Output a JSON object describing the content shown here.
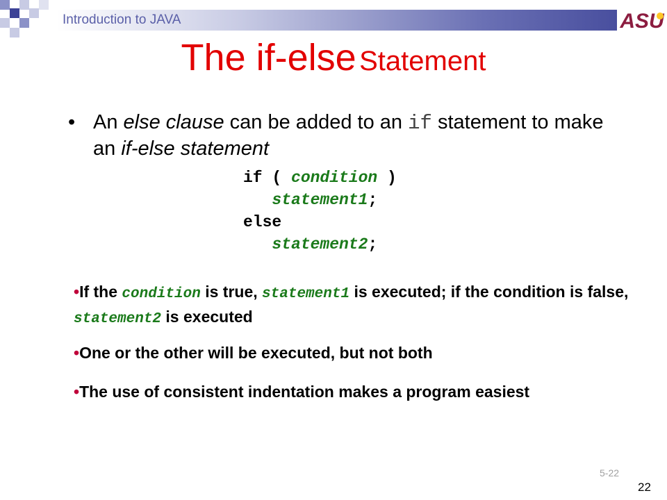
{
  "header": {
    "title": "Introduction to JAVA",
    "logo_text": "ASU"
  },
  "colors": {
    "title": "#e20000",
    "code_green": "#1a7a1a",
    "bullet_red": "#c0003a",
    "header_blue": "#3c4296"
  },
  "title": {
    "part1": "The if-else",
    "part2": "Statement"
  },
  "bullet": {
    "marker": "•",
    "t1": "An ",
    "t2": "else clause",
    "t3": " can be added to an ",
    "t4": "if",
    "t5": " statement to make an ",
    "t6": "if-else statement"
  },
  "code": {
    "l1a": "if ( ",
    "l1b": "condition",
    "l1c": " )",
    "l2a": "statement1",
    "l2b": ";",
    "l3": "else",
    "l4a": "statement2",
    "l4b": ";"
  },
  "sub1": {
    "marker": "•",
    "a": "If the ",
    "b": "condition",
    "c": " is true, ",
    "d": "statement1",
    "e": " is executed;  if the condition is false, ",
    "f": "statement2",
    "g": " is executed"
  },
  "sub2": {
    "marker": "•",
    "text": "One or the other will be executed, but not both"
  },
  "sub3": {
    "marker": "•",
    "text": "The use of consistent indentation makes a program easiest"
  },
  "footer": {
    "slide_ref": "5-22",
    "page_number": "22"
  }
}
